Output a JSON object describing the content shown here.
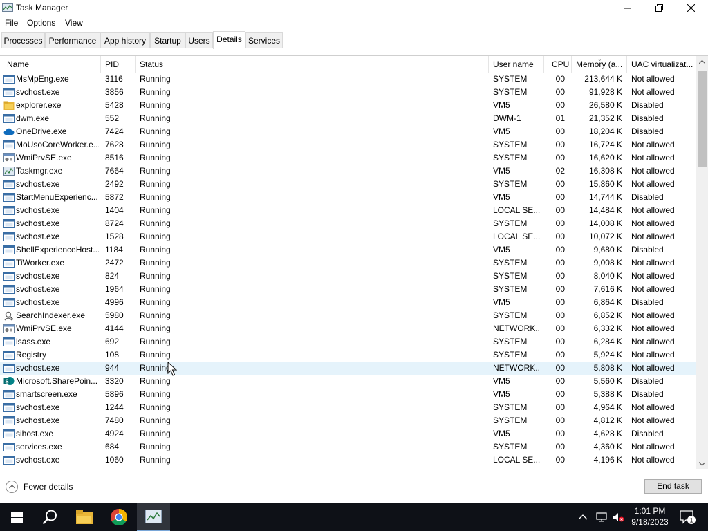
{
  "window": {
    "title": "Task Manager"
  },
  "menu": [
    "File",
    "Options",
    "View"
  ],
  "tabs": [
    "Processes",
    "Performance",
    "App history",
    "Startup",
    "Users",
    "Details",
    "Services"
  ],
  "active_tab": "Details",
  "columns": [
    "Name",
    "PID",
    "Status",
    "User name",
    "CPU",
    "Memory (a...",
    "UAC virtualizat..."
  ],
  "rows": [
    {
      "name": "MsMpEng.exe",
      "pid": "3116",
      "status": "Running",
      "user": "SYSTEM",
      "cpu": "00",
      "mem": "213,644 K",
      "uac": "Not allowed",
      "icon": "window-icon"
    },
    {
      "name": "svchost.exe",
      "pid": "3856",
      "status": "Running",
      "user": "SYSTEM",
      "cpu": "00",
      "mem": "91,928 K",
      "uac": "Not allowed",
      "icon": "window-icon"
    },
    {
      "name": "explorer.exe",
      "pid": "5428",
      "status": "Running",
      "user": "VM5",
      "cpu": "00",
      "mem": "26,580 K",
      "uac": "Disabled",
      "icon": "folder-icon"
    },
    {
      "name": "dwm.exe",
      "pid": "552",
      "status": "Running",
      "user": "DWM-1",
      "cpu": "01",
      "mem": "21,352 K",
      "uac": "Disabled",
      "icon": "window-icon"
    },
    {
      "name": "OneDrive.exe",
      "pid": "7424",
      "status": "Running",
      "user": "VM5",
      "cpu": "00",
      "mem": "18,204 K",
      "uac": "Disabled",
      "icon": "cloud-icon"
    },
    {
      "name": "MoUsoCoreWorker.e...",
      "pid": "7628",
      "status": "Running",
      "user": "SYSTEM",
      "cpu": "00",
      "mem": "16,724 K",
      "uac": "Not allowed",
      "icon": "window-icon"
    },
    {
      "name": "WmiPrvSE.exe",
      "pid": "8516",
      "status": "Running",
      "user": "SYSTEM",
      "cpu": "00",
      "mem": "16,620 K",
      "uac": "Not allowed",
      "icon": "gear-window-icon"
    },
    {
      "name": "Taskmgr.exe",
      "pid": "7664",
      "status": "Running",
      "user": "VM5",
      "cpu": "02",
      "mem": "16,308 K",
      "uac": "Not allowed",
      "icon": "taskmgr-icon"
    },
    {
      "name": "svchost.exe",
      "pid": "2492",
      "status": "Running",
      "user": "SYSTEM",
      "cpu": "00",
      "mem": "15,860 K",
      "uac": "Not allowed",
      "icon": "window-icon"
    },
    {
      "name": "StartMenuExperienc...",
      "pid": "5872",
      "status": "Running",
      "user": "VM5",
      "cpu": "00",
      "mem": "14,744 K",
      "uac": "Disabled",
      "icon": "window-icon"
    },
    {
      "name": "svchost.exe",
      "pid": "1404",
      "status": "Running",
      "user": "LOCAL SE...",
      "cpu": "00",
      "mem": "14,484 K",
      "uac": "Not allowed",
      "icon": "window-icon"
    },
    {
      "name": "svchost.exe",
      "pid": "8724",
      "status": "Running",
      "user": "SYSTEM",
      "cpu": "00",
      "mem": "14,008 K",
      "uac": "Not allowed",
      "icon": "window-icon"
    },
    {
      "name": "svchost.exe",
      "pid": "1528",
      "status": "Running",
      "user": "LOCAL SE...",
      "cpu": "00",
      "mem": "10,072 K",
      "uac": "Not allowed",
      "icon": "window-icon"
    },
    {
      "name": "ShellExperienceHost....",
      "pid": "1184",
      "status": "Running",
      "user": "VM5",
      "cpu": "00",
      "mem": "9,680 K",
      "uac": "Disabled",
      "icon": "window-icon"
    },
    {
      "name": "TiWorker.exe",
      "pid": "2472",
      "status": "Running",
      "user": "SYSTEM",
      "cpu": "00",
      "mem": "9,008 K",
      "uac": "Not allowed",
      "icon": "window-icon"
    },
    {
      "name": "svchost.exe",
      "pid": "824",
      "status": "Running",
      "user": "SYSTEM",
      "cpu": "00",
      "mem": "8,040 K",
      "uac": "Not allowed",
      "icon": "window-icon"
    },
    {
      "name": "svchost.exe",
      "pid": "1964",
      "status": "Running",
      "user": "SYSTEM",
      "cpu": "00",
      "mem": "7,616 K",
      "uac": "Not allowed",
      "icon": "window-icon"
    },
    {
      "name": "svchost.exe",
      "pid": "4996",
      "status": "Running",
      "user": "VM5",
      "cpu": "00",
      "mem": "6,864 K",
      "uac": "Disabled",
      "icon": "window-icon"
    },
    {
      "name": "SearchIndexer.exe",
      "pid": "5980",
      "status": "Running",
      "user": "SYSTEM",
      "cpu": "00",
      "mem": "6,852 K",
      "uac": "Not allowed",
      "icon": "search-person-icon"
    },
    {
      "name": "WmiPrvSE.exe",
      "pid": "4144",
      "status": "Running",
      "user": "NETWORK...",
      "cpu": "00",
      "mem": "6,332 K",
      "uac": "Not allowed",
      "icon": "gear-window-icon"
    },
    {
      "name": "lsass.exe",
      "pid": "692",
      "status": "Running",
      "user": "SYSTEM",
      "cpu": "00",
      "mem": "6,284 K",
      "uac": "Not allowed",
      "icon": "window-icon"
    },
    {
      "name": "Registry",
      "pid": "108",
      "status": "Running",
      "user": "SYSTEM",
      "cpu": "00",
      "mem": "5,924 K",
      "uac": "Not allowed",
      "icon": "window-icon"
    },
    {
      "name": "svchost.exe",
      "pid": "944",
      "status": "Running",
      "user": "NETWORK...",
      "cpu": "00",
      "mem": "5,808 K",
      "uac": "Not allowed",
      "icon": "window-icon"
    },
    {
      "name": "Microsoft.SharePoin...",
      "pid": "3320",
      "status": "Running",
      "user": "VM5",
      "cpu": "00",
      "mem": "5,560 K",
      "uac": "Disabled",
      "icon": "sharepoint-icon"
    },
    {
      "name": "smartscreen.exe",
      "pid": "5896",
      "status": "Running",
      "user": "VM5",
      "cpu": "00",
      "mem": "5,388 K",
      "uac": "Disabled",
      "icon": "window-icon"
    },
    {
      "name": "svchost.exe",
      "pid": "1244",
      "status": "Running",
      "user": "SYSTEM",
      "cpu": "00",
      "mem": "4,964 K",
      "uac": "Not allowed",
      "icon": "window-icon"
    },
    {
      "name": "svchost.exe",
      "pid": "7480",
      "status": "Running",
      "user": "SYSTEM",
      "cpu": "00",
      "mem": "4,812 K",
      "uac": "Not allowed",
      "icon": "window-icon"
    },
    {
      "name": "sihost.exe",
      "pid": "4924",
      "status": "Running",
      "user": "VM5",
      "cpu": "00",
      "mem": "4,628 K",
      "uac": "Disabled",
      "icon": "window-icon"
    },
    {
      "name": "services.exe",
      "pid": "684",
      "status": "Running",
      "user": "SYSTEM",
      "cpu": "00",
      "mem": "4,360 K",
      "uac": "Not allowed",
      "icon": "window-icon"
    },
    {
      "name": "svchost.exe",
      "pid": "1060",
      "status": "Running",
      "user": "LOCAL SE...",
      "cpu": "00",
      "mem": "4,196 K",
      "uac": "Not allowed",
      "icon": "window-icon"
    }
  ],
  "highlighted_row_pid": "944",
  "footer": {
    "fewer_details": "Fewer details",
    "end_task": "End task"
  },
  "taskbar": {
    "apps": [
      "start-icon",
      "search-icon",
      "file-explorer-icon",
      "chrome-icon",
      "taskmgr-icon"
    ],
    "time": "1:01 PM",
    "date": "9/18/2023",
    "notification_count": "1"
  },
  "colors": {
    "selection": "#e5f3fb",
    "taskbar": "#0e1117",
    "sharepoint": "#038387",
    "onedrive": "#0f6cbd"
  }
}
